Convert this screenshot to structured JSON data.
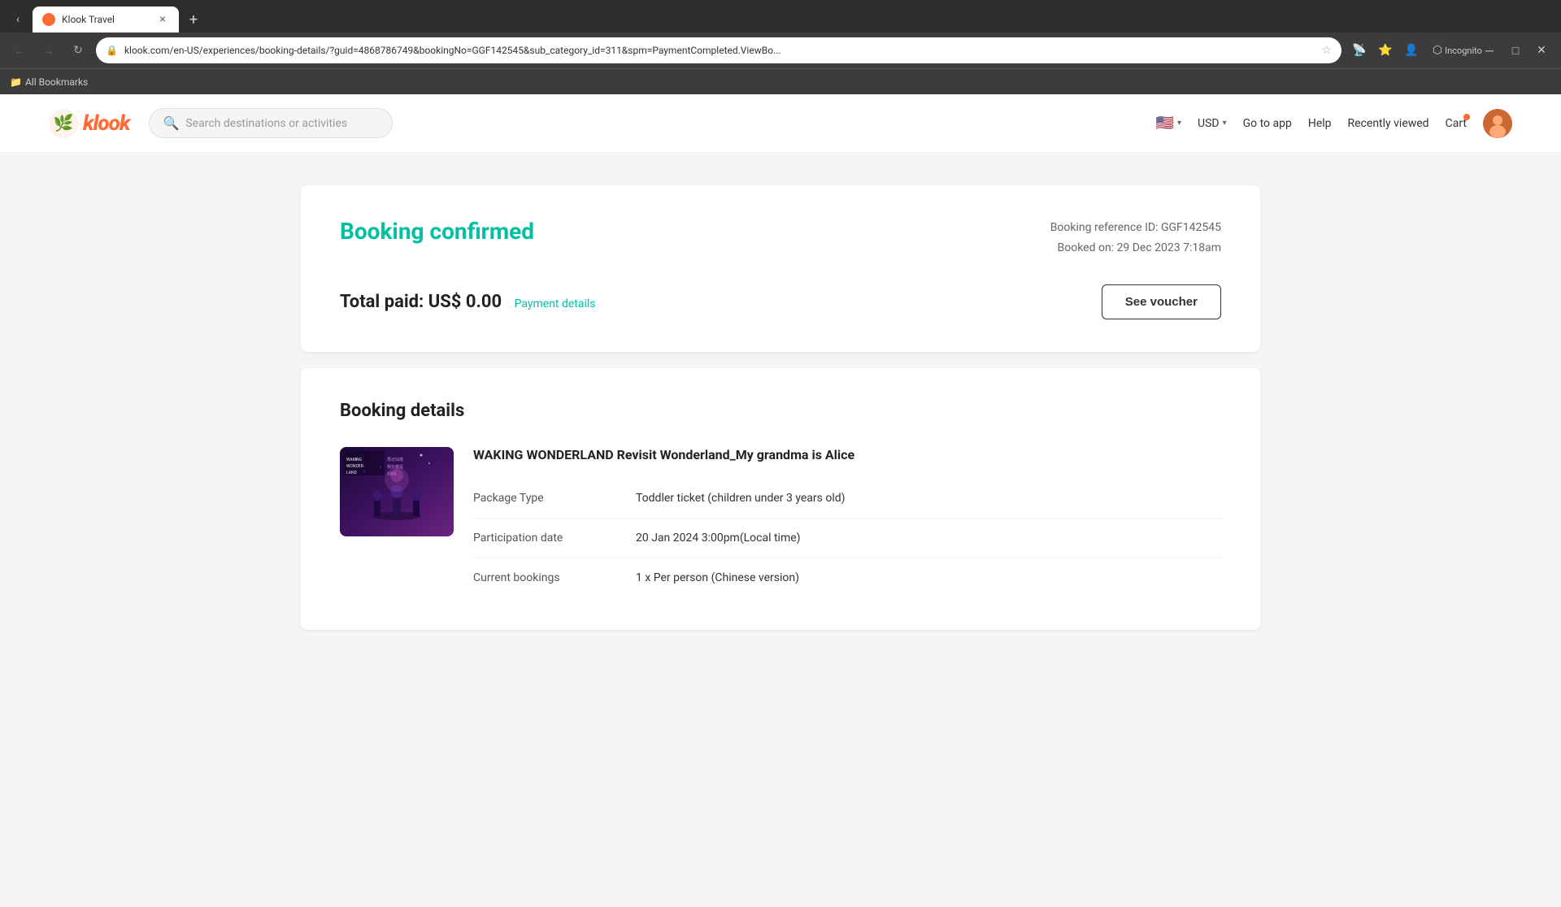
{
  "browser": {
    "tab_title": "Klook Travel",
    "tab_close": "×",
    "tab_new": "+",
    "url": "klook.com/en-US/experiences/booking-details/?guid=4868786749&bookingNo=GGF142545&sub_category_id=311&spm=PaymentCompleted.ViewBo...",
    "nav_back": "←",
    "nav_forward": "→",
    "nav_refresh": "↻",
    "incognito_label": "Incognito",
    "bookmarks_label": "All Bookmarks"
  },
  "header": {
    "logo_text": "klook",
    "search_placeholder": "Search destinations or activities",
    "lang_flag": "🇺🇸",
    "currency": "USD",
    "currency_arrow": "▾",
    "go_to_app": "Go to app",
    "help": "Help",
    "recently_viewed": "Recently viewed",
    "cart": "Cart",
    "avatar_initial": "👤"
  },
  "booking_confirmed": {
    "title": "Booking confirmed",
    "ref_label": "Booking reference ID: GGF142545",
    "booked_on": "Booked on: 29 Dec 2023 7:18am",
    "total_paid_label": "Total paid: US$ 0.00",
    "payment_details": "Payment details",
    "see_voucher": "See voucher"
  },
  "booking_details": {
    "title": "Booking details",
    "activity_title": "WAKING WONDERLAND Revisit Wonderland_My grandma is Alice",
    "image_alt": "Waking Wonderland",
    "details": [
      {
        "label": "Package Type",
        "value": "Toddler ticket (children under 3 years old)"
      },
      {
        "label": "Participation date",
        "value": "20 Jan 2024 3:00pm(Local time)"
      },
      {
        "label": "Current bookings",
        "value": "1 x Per person (Chinese version)"
      }
    ]
  }
}
